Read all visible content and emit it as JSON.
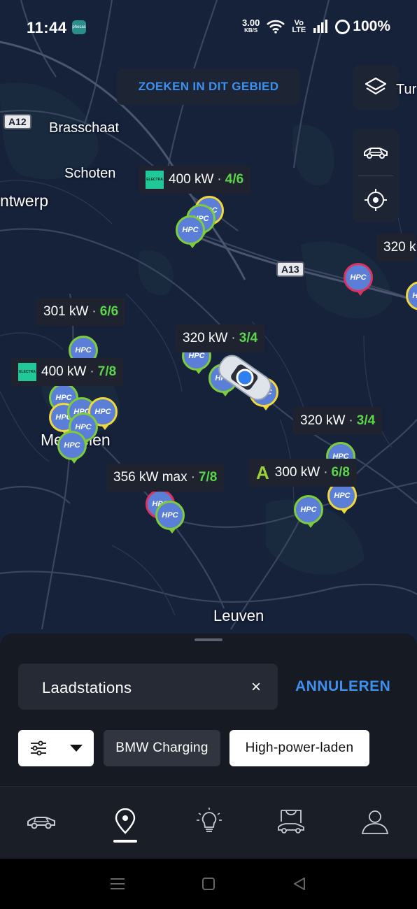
{
  "status_bar": {
    "time": "11:44",
    "app_icon_text": "phocas",
    "net_speed": "3.00",
    "net_speed_unit": "KB/S",
    "volte_top": "Vo",
    "volte_bottom": "LTE",
    "battery": "100%"
  },
  "map": {
    "search_area_button": "ZOEKEN IN DIT GEBIED",
    "places": {
      "brasschaat": "Brasschaat",
      "schoten": "Schoten",
      "antwerp": "ntwerp",
      "mechelen": "Mechelen",
      "leuven": "Leuven",
      "turnhout": "Tur"
    },
    "road_labels": {
      "a12": "A12",
      "a13": "A13"
    },
    "pin_label": "HPC",
    "stations": [
      {
        "operator": "ELECTRA",
        "power": "400 kW",
        "available": "4/6"
      },
      {
        "operator": "",
        "power": "301 kW",
        "available": "6/6"
      },
      {
        "operator": "ELECTRA",
        "power": "400 kW",
        "available": "7/8"
      },
      {
        "operator": "",
        "power": "320 kW",
        "available": "3/4"
      },
      {
        "operator": "",
        "power": "320 kW",
        "available": "3/4"
      },
      {
        "operator": "",
        "power": "356 kW max",
        "available": "7/8"
      },
      {
        "operator": "A",
        "power": "300 kW",
        "available": "6/8"
      },
      {
        "operator": "",
        "power": "320 k",
        "available": ""
      }
    ]
  },
  "sheet": {
    "search_value": "Laadstations",
    "clear_symbol": "×",
    "cancel_label": "ANNULEREN",
    "chips": {
      "bmw": "BMW Charging",
      "high_power": "High-power-laden"
    }
  },
  "tabbar": {
    "tabs": [
      "vehicle-icon",
      "map-pin-icon",
      "lightbulb-icon",
      "shop-icon",
      "profile-icon"
    ],
    "active": "map-pin-icon"
  },
  "colors": {
    "accent_blue": "#3d8ff0",
    "availability_green": "#5ad54a",
    "map_bg": "#16213a",
    "sheet_bg": "#161a22"
  }
}
